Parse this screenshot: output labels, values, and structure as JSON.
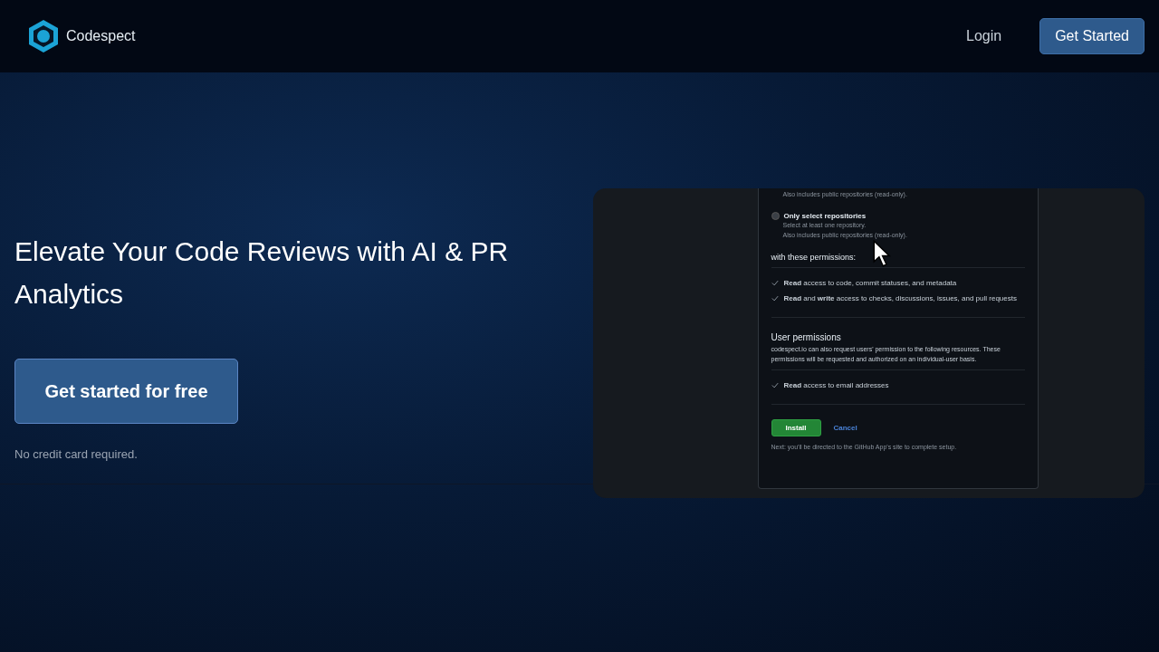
{
  "header": {
    "brand": "Codespect",
    "login": "Login",
    "cta": "Get Started"
  },
  "hero": {
    "title": "Elevate Your Code Reviews with AI & PR Analytics",
    "button": "Get started for free",
    "note": "No credit card required."
  },
  "preview": {
    "top_note": "Also includes public repositories (read-only).",
    "option": {
      "label": "Only select repositories",
      "selected": false,
      "lines": [
        "Select at least one repository.",
        "Also includes public repositories (read-only)."
      ]
    },
    "permissions_heading": "with these permissions:",
    "repo_permissions": [
      "**Read** access to code, commit statuses, and metadata",
      "**Read** and **write** access to checks, discussions, issues, and pull requests"
    ],
    "user_heading": "User permissions",
    "user_description": "codespect.io can also request users' permission to the following resources. These permissions will be requested and authorized on an individual-user basis.",
    "user_permissions": [
      "**Read** access to email addresses"
    ],
    "install": "Install",
    "cancel": "Cancel",
    "footnote": "Next: you'll be directed to the GitHub App's site to complete setup."
  }
}
